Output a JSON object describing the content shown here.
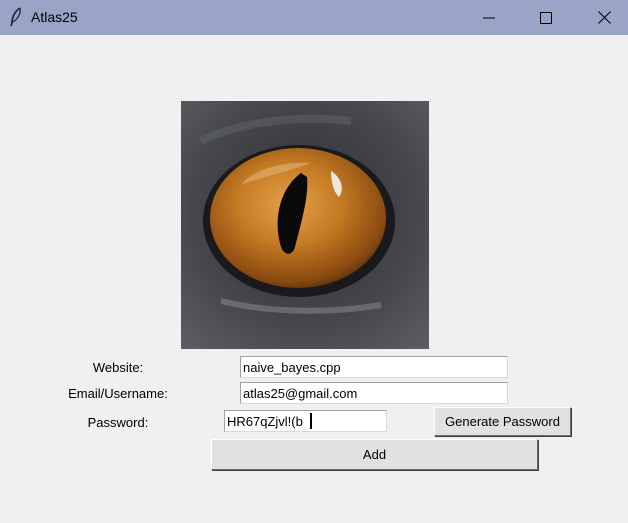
{
  "window": {
    "title": "Atlas25",
    "icon": "feather-icon",
    "controls": [
      "minimize-icon",
      "maximize-icon",
      "close-icon"
    ]
  },
  "image": {
    "description_icon": "cat-eye-image"
  },
  "form": {
    "website_label": "Website:",
    "website_value": "naive_bayes.cpp",
    "email_label": "Email/Username:",
    "email_value": "atlas25@gmail.com",
    "password_label": "Password:",
    "password_value": "HR67qZjvl!(b",
    "generate_label": "Generate Password",
    "add_label": "Add"
  },
  "colors": {
    "titlebar": "#99a4c6",
    "background": "#f0f0f0"
  }
}
